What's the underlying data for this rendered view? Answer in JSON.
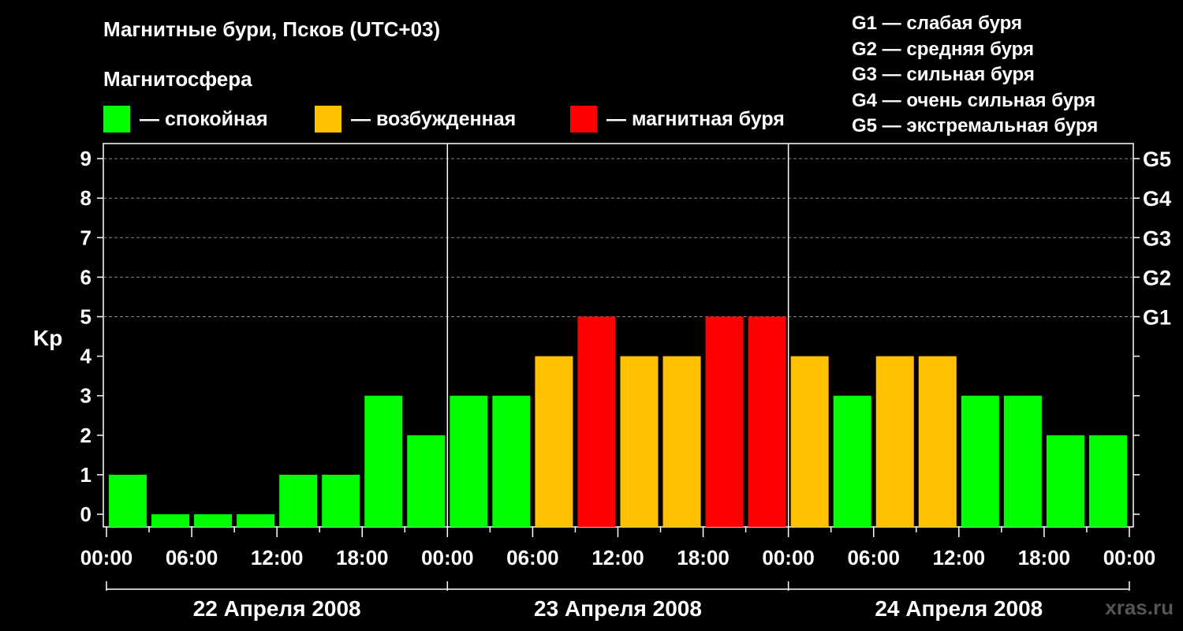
{
  "title": "Магнитные бури, Псков (UTC+03)",
  "subtitle": "Магнитосфера",
  "legend": [
    {
      "label": "— спокойная",
      "color": "#00FF00"
    },
    {
      "label": "— возбужденная",
      "color": "#FFC000"
    },
    {
      "label": "— магнитная буря",
      "color": "#FF0000"
    }
  ],
  "storm_legend": [
    "G1 — слабая буря",
    "G2 — средняя буря",
    "G3 — сильная буря",
    "G4 — очень сильная буря",
    "G5 — экстремальная буря"
  ],
  "watermark": "xras.ru",
  "chart_data": {
    "type": "bar",
    "ylabel": "Kp",
    "ylim": [
      0,
      9
    ],
    "yticks": [
      0,
      1,
      2,
      3,
      4,
      5,
      6,
      7,
      8,
      9
    ],
    "right_axis_labels": [
      {
        "value": 5,
        "label": "G1"
      },
      {
        "value": 6,
        "label": "G2"
      },
      {
        "value": 7,
        "label": "G3"
      },
      {
        "value": 8,
        "label": "G4"
      },
      {
        "value": 9,
        "label": "G5"
      }
    ],
    "x_tick_labels": [
      "00:00",
      "06:00",
      "12:00",
      "18:00",
      "00:00",
      "06:00",
      "12:00",
      "18:00",
      "00:00",
      "06:00",
      "12:00",
      "18:00",
      "00:00"
    ],
    "days": [
      "22 Апреля 2008",
      "23 Апреля 2008",
      "24 Апреля 2008"
    ],
    "interval_hours": 3,
    "values": [
      1,
      0,
      0,
      0,
      1,
      1,
      3,
      2,
      3,
      3,
      4,
      5,
      4,
      4,
      5,
      5,
      4,
      3,
      4,
      4,
      3,
      3,
      2,
      2
    ],
    "colors": {
      "calm": "#00FF00",
      "active": "#FFC000",
      "storm": "#FF0000"
    },
    "thresholds": {
      "active_min": 4,
      "storm_min": 5
    },
    "grid": "dashed horizontal",
    "legend_position": "top"
  }
}
